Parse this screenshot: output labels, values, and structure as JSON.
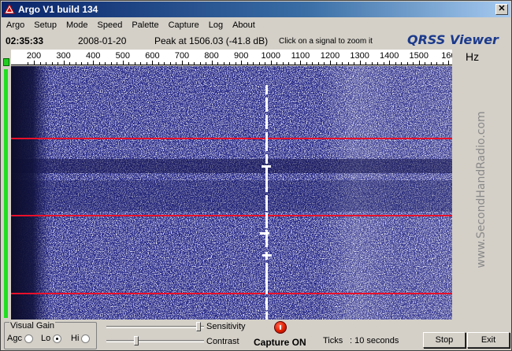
{
  "window": {
    "title": "Argo V1 build 134",
    "close_glyph": "✕"
  },
  "menu": [
    "Argo",
    "Setup",
    "Mode",
    "Speed",
    "Palette",
    "Capture",
    "Log",
    "About"
  ],
  "info": {
    "clock": "02:35:33",
    "date": "2008-01-20",
    "peak": "Peak at 1506.03 (-41.8 dB)",
    "hint": "Click on a signal to zoom it",
    "brand": "QRSS Viewer",
    "unit": "Hz"
  },
  "scale": {
    "labels": [
      "200",
      "300",
      "400",
      "500",
      "600",
      "700",
      "800",
      "900",
      "1000",
      "1100",
      "1200",
      "1300",
      "1400",
      "1500",
      "160"
    ]
  },
  "watermark": "www.SecondHandRadio.com",
  "controls": {
    "visual_gain_label": "Visual Gain",
    "agc_label": "Agc",
    "lo_label": "Lo",
    "hi_label": "Hi",
    "selected_gain": "Lo",
    "sensitivity_label": "Sensitivity",
    "contrast_label": "Contrast",
    "sensitivity_level": 0.97,
    "contrast_level": 0.3,
    "capture_status": "Capture ON",
    "ticks_label": "Ticks",
    "ticks_value": ": 10 seconds",
    "stop_label": "Stop",
    "exit_label": "Exit"
  },
  "colors": {
    "waterfall_bg": "#2a2c8a",
    "grid_line": "#e8102a",
    "signal": "#ffffff",
    "agc_meter": "#22dd22"
  }
}
